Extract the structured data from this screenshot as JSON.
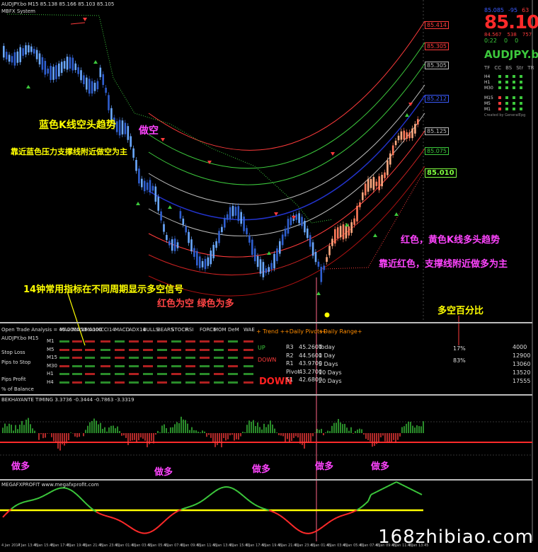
{
  "header": {
    "symbol_line": "AUDJPY.bo M15  85.138 85.166 85.103 85.105",
    "indicator_label": "MBFX System"
  },
  "price_panel": {
    "bid_small": "85.085",
    "spread_small": "-95",
    "pct_small": "63",
    "big_price": "85.105",
    "low": "84.567",
    "pts": "538",
    "high": "757",
    "timer": "0:22",
    "symbol": "AUDJPY.bo",
    "tf_headers": [
      "TF",
      "CC",
      "BS",
      "Str",
      "TR"
    ],
    "tf_rows": [
      "H4",
      "H1",
      "M30",
      "M15",
      "M5",
      "M1"
    ],
    "credit": "Created by GeneralEpg"
  },
  "right_axis": {
    "tags": [
      {
        "label": "85.414",
        "color": "#ff3b3b"
      },
      {
        "label": "85.305",
        "color": "#ff3b3b"
      },
      {
        "label": "85.305",
        "color": "#bbbbbb"
      },
      {
        "label": "85.212",
        "color": "#3b5bff"
      },
      {
        "label": "85.125",
        "color": "#bbbbbb"
      },
      {
        "label": "85.075",
        "color": "#3cc83c"
      },
      {
        "label": "85.010",
        "color": "#7fff3f"
      }
    ]
  },
  "annotations": {
    "blue_trend": "蓝色K线空头趋势",
    "blue_near": "靠近蓝色压力支撑线附近做空为主",
    "short_top": "做空",
    "red_trend": "红色，黄色K线多头趋势",
    "red_near": "靠近红色，支撑线附近做多为主",
    "indicator_note": "14钟常用指标在不同周期显示多空信号",
    "red_short": "红色为空 绿色为多",
    "ratio_note": "多空百分比",
    "long_labels": [
      "做多",
      "做多",
      "做多",
      "做多",
      "做多"
    ]
  },
  "analysis_panel": {
    "title": "Open Trade Analysis",
    "title_value": "= 46.0000 16.0000",
    "symbol": "AUDJPY.bo M15",
    "left_items": [
      "Stop Loss",
      "Pips to Stop",
      "Pips Profit",
      "% of Balance"
    ],
    "columns": [
      "MA20",
      "MA50",
      "MA100",
      "CCI14",
      "MACD",
      "ADX14",
      "BULLS",
      "BEARS",
      "STOCH",
      "RSI",
      "FORCE",
      "MOM",
      "DeM",
      "WAE"
    ],
    "rows": [
      "M1",
      "M5",
      "M15",
      "M30",
      "H1",
      "H4"
    ],
    "trend_header": "+ Trend +",
    "trend_up": "UP",
    "trend_down": "DOWN",
    "trend_big": "DOWN",
    "pivot_header": "+Daily Pivots+",
    "pivots": [
      {
        "name": "R3",
        "value": "45.2600"
      },
      {
        "name": "R2",
        "value": "44.5600"
      },
      {
        "name": "R1",
        "value": "43.9700"
      },
      {
        "name": "Pivot",
        "value": "43.2700"
      },
      {
        "name": "S1",
        "value": "42.6800"
      }
    ],
    "range_header": "+Daily Range+",
    "ranges": [
      {
        "name": "Today",
        "value": "4000"
      },
      {
        "name": "1 Day",
        "value": "12900"
      },
      {
        "name": "5 Days",
        "value": "13060"
      },
      {
        "name": "10 Days",
        "value": "13520"
      },
      {
        "name": "20 Days",
        "value": "17555"
      }
    ],
    "pct_high": "17%",
    "pct_low": "83%"
  },
  "momentum_panel": {
    "label": "BEKHAYANTE TIMING 3.3736 -0.3444 -0.7863 -3.3319"
  },
  "oscillator_panel": {
    "label": "MEGAFXPROFIT  www.megafxprofit.com"
  },
  "time_axis": [
    "4 Jan 2017",
    "4 Jan 13:45",
    "4 Jan 15:45",
    "4 Jan 17:45",
    "4 Jan 19:45",
    "4 Jan 21:45",
    "4 Jan 23:45",
    "5 Jan 01:45",
    "5 Jan 03:45",
    "5 Jan 05:45",
    "5 Jan 07:45",
    "5 Jan 09:45",
    "5 Jan 11:45",
    "5 Jan 13:45",
    "5 Jan 15:45",
    "5 Jan 17:45",
    "5 Jan 19:45",
    "5 Jan 21:45",
    "5 Jan 23:45",
    "6 Jan 01:45",
    "6 Jan 03:45",
    "6 Jan 05:45",
    "6 Jan 07:45",
    "6 Jan 09:45",
    "6 Jan 11:45",
    "6 Jan 13:45"
  ],
  "watermark": "168zhibiao.com"
}
